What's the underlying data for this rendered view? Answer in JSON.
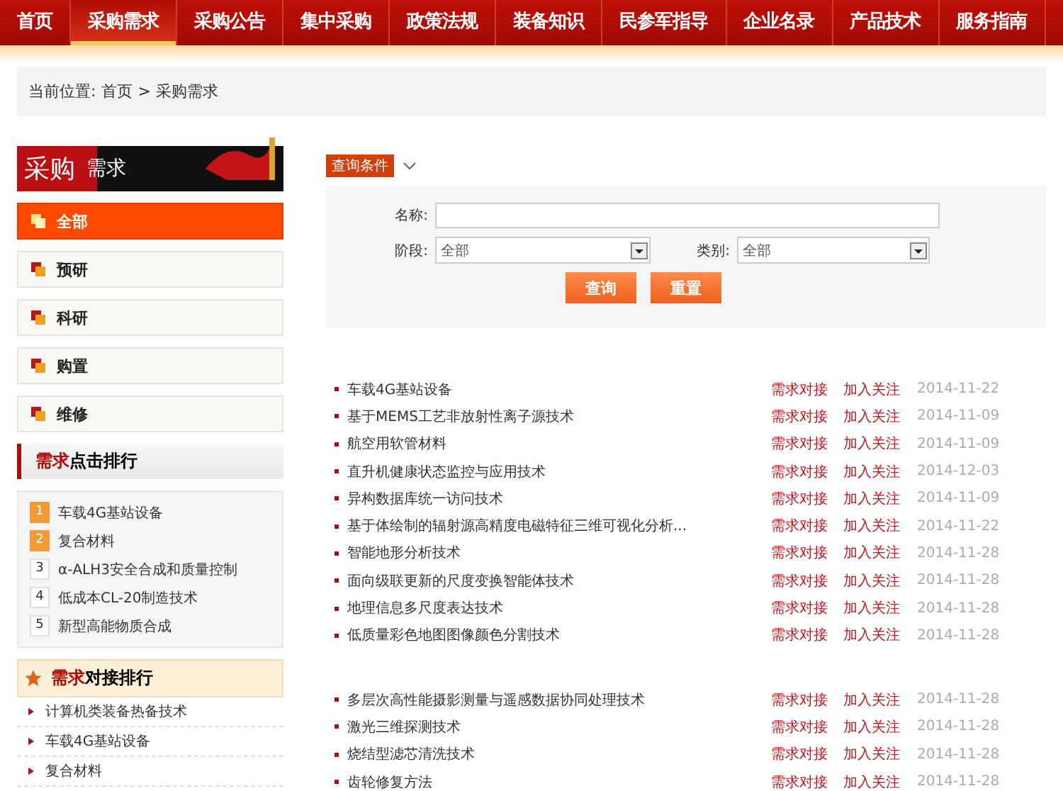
{
  "nav": [
    {
      "label": "首页",
      "selected": false
    },
    {
      "label": "采购需求",
      "selected": true
    },
    {
      "label": "采购公告",
      "selected": false
    },
    {
      "label": "集中采购",
      "selected": false
    },
    {
      "label": "政策法规",
      "selected": false
    },
    {
      "label": "装备知识",
      "selected": false
    },
    {
      "label": "民参军指导",
      "selected": false
    },
    {
      "label": "企业名录",
      "selected": false
    },
    {
      "label": "产品技术",
      "selected": false
    },
    {
      "label": "服务指南",
      "selected": false
    }
  ],
  "breadcrumb": {
    "label": "当前位置:",
    "path": "首页 > 采购需求"
  },
  "sidebar": {
    "banner": {
      "title": "采购",
      "subtitle": "需求"
    },
    "categories": [
      {
        "label": "全部",
        "selected": true
      },
      {
        "label": "预研",
        "selected": false
      },
      {
        "label": "科研",
        "selected": false
      },
      {
        "label": "购置",
        "selected": false
      },
      {
        "label": "维修",
        "selected": false
      }
    ],
    "click_ranking": {
      "title_highlight": "需求",
      "title": "点击排行",
      "items": [
        {
          "rank": "1",
          "label": "车载4G基站设备",
          "top": true
        },
        {
          "rank": "2",
          "label": "复合材料",
          "top": true
        },
        {
          "rank": "3",
          "label": "α-ALH3安全合成和质量控制",
          "top": false
        },
        {
          "rank": "4",
          "label": "低成本CL-20制造技术",
          "top": false
        },
        {
          "rank": "5",
          "label": "新型高能物质合成",
          "top": false
        }
      ]
    },
    "match_ranking": {
      "title_highlight": "需求",
      "title": "对接排行",
      "items": [
        "计算机类装备热备技术",
        "车载4G基站设备",
        "复合材料"
      ]
    }
  },
  "query": {
    "tag": "查询条件",
    "name_field": {
      "label": "名称:"
    },
    "stage_field": {
      "label": "阶段:",
      "value": "全部"
    },
    "type_field": {
      "label": "类别:",
      "value": "全部"
    },
    "buttons": [
      "查询",
      "重置"
    ]
  },
  "groups": [
    [
      {
        "title": "车载4G基站设备",
        "action": "需求对接",
        "follow": "加入关注",
        "date": "2014-11-22"
      },
      {
        "title": "基于MEMS工艺非放射性离子源技术",
        "action": "需求对接",
        "follow": "加入关注",
        "date": "2014-11-09"
      },
      {
        "title": "航空用软管材料",
        "action": "需求对接",
        "follow": "加入关注",
        "date": "2014-11-09"
      },
      {
        "title": "直升机健康状态监控与应用技术",
        "action": "需求对接",
        "follow": "加入关注",
        "date": "2014-12-03"
      },
      {
        "title": "异构数据库统一访问技术",
        "action": "需求对接",
        "follow": "加入关注",
        "date": "2014-11-09"
      },
      {
        "title": "基于体绘制的辐射源高精度电磁特征三维可视化分析...",
        "action": "需求对接",
        "follow": "加入关注",
        "date": "2014-11-22"
      },
      {
        "title": "智能地形分析技术",
        "action": "需求对接",
        "follow": "加入关注",
        "date": "2014-11-28"
      },
      {
        "title": "面向级联更新的尺度变换智能体技术",
        "action": "需求对接",
        "follow": "加入关注",
        "date": "2014-11-28"
      },
      {
        "title": "地理信息多尺度表达技术",
        "action": "需求对接",
        "follow": "加入关注",
        "date": "2014-11-28"
      },
      {
        "title": "低质量彩色地图图像颜色分割技术",
        "action": "需求对接",
        "follow": "加入关注",
        "date": "2014-11-28"
      }
    ],
    [
      {
        "title": "多层次高性能摄影测量与遥感数据协同处理技术",
        "action": "需求对接",
        "follow": "加入关注",
        "date": "2014-11-28"
      },
      {
        "title": "激光三维探测技术",
        "action": "需求对接",
        "follow": "加入关注",
        "date": "2014-11-28"
      },
      {
        "title": "烧结型滤芯清洗技术",
        "action": "需求对接",
        "follow": "加入关注",
        "date": "2014-11-28"
      },
      {
        "title": "齿轮修复方法",
        "action": "需求对接",
        "follow": "加入关注",
        "date": "2014-11-28"
      }
    ]
  ]
}
